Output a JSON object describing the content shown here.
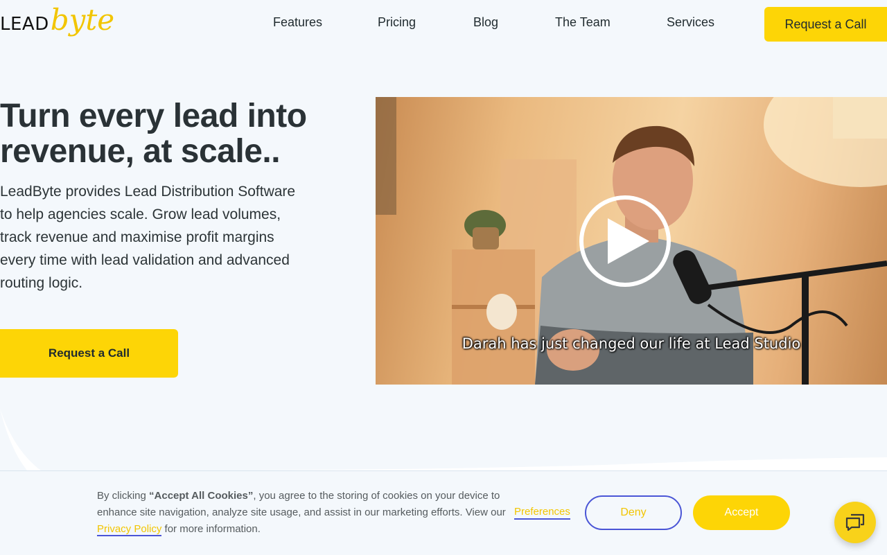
{
  "header": {
    "logo": {
      "lead": "LEAD",
      "byte": "byte"
    },
    "nav": [
      {
        "label": "Features"
      },
      {
        "label": "Pricing"
      },
      {
        "label": "Blog"
      },
      {
        "label": "The Team"
      },
      {
        "label": "Services"
      }
    ],
    "cta_label": "Request a Call"
  },
  "hero": {
    "title": "Turn every lead into revenue, at scale..",
    "body": "LeadByte provides Lead Distribution Software to help agencies scale. Grow lead volumes, track revenue and maximise profit margins every time with lead validation and advanced routing logic.",
    "cta_label": "Request a Call",
    "video": {
      "caption": "Darah has just changed our life at Lead Studio",
      "play_icon": "play-icon"
    }
  },
  "cookie_banner": {
    "text_prefix": "By clicking ",
    "text_bold": "“Accept All Cookies”",
    "text_middle": ", you agree to the storing of cookies on your device to enhance site navigation, analyze site usage, and assist in our marketing efforts. View our ",
    "privacy_link": "Privacy Policy",
    "text_suffix": " for more information.",
    "preferences_label": "Preferences",
    "deny_label": "Deny",
    "accept_label": "Accept"
  },
  "chat": {
    "icon": "chat-icon"
  },
  "colors": {
    "brand_yellow": "#fdd506",
    "link_underline": "#4a55d6",
    "background": "#f4f8fc",
    "text_dark": "#2a3236"
  }
}
